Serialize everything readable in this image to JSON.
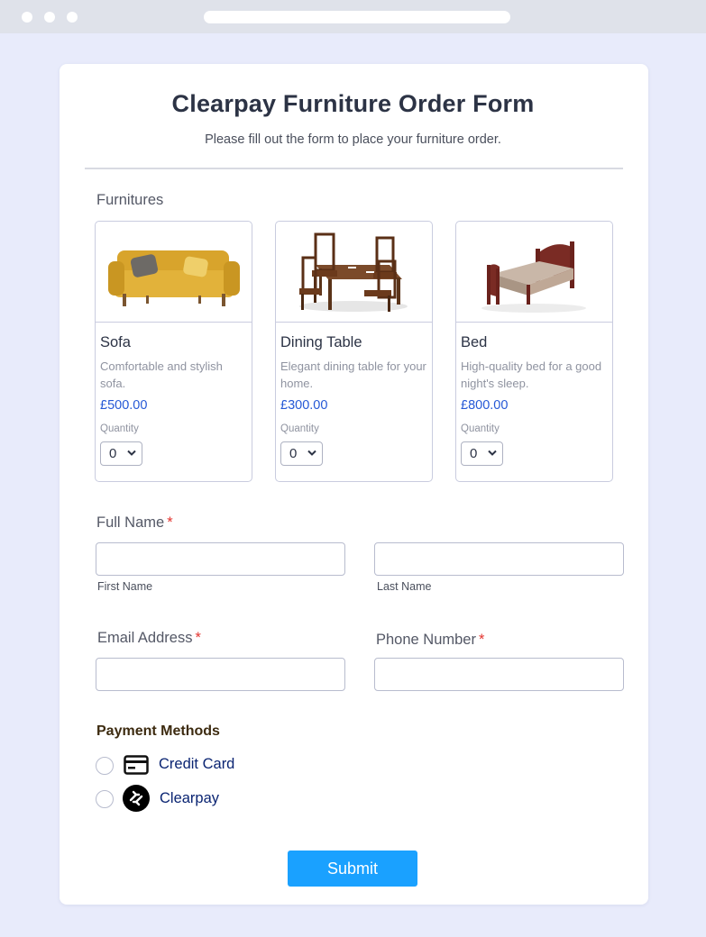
{
  "form": {
    "title": "Clearpay Furniture Order Form",
    "subtitle": "Please fill out the form to place your furniture order."
  },
  "furnitures": {
    "label": "Furnitures",
    "quantity_label": "Quantity",
    "products": [
      {
        "name": "Sofa",
        "description": "Comfortable and stylish sofa.",
        "price": "£500.00",
        "quantity": "0",
        "image_icon": "sofa-image"
      },
      {
        "name": "Dining Table",
        "description": "Elegant dining table for your home.",
        "price": "£300.00",
        "quantity": "0",
        "image_icon": "dining-table-image"
      },
      {
        "name": "Bed",
        "description": "High-quality bed for a good night's sleep.",
        "price": "£800.00",
        "quantity": "0",
        "image_icon": "bed-image"
      }
    ]
  },
  "full_name": {
    "label": "Full Name",
    "required_mark": "*",
    "first_name_sublabel": "First Name",
    "last_name_sublabel": "Last Name",
    "first_name_value": "",
    "last_name_value": ""
  },
  "email": {
    "label": "Email Address",
    "required_mark": "*",
    "value": ""
  },
  "phone": {
    "label": "Phone Number",
    "required_mark": "*",
    "value": ""
  },
  "payment": {
    "label": "Payment Methods",
    "options": [
      {
        "label": "Credit Card",
        "icon": "credit-card-icon",
        "selected": false
      },
      {
        "label": "Clearpay",
        "icon": "clearpay-logo-icon",
        "selected": false
      }
    ]
  },
  "submit_label": "Submit",
  "colors": {
    "page_background": "#e8ebfb",
    "accent": "#1aa1ff",
    "price": "#2659d6",
    "required": "#e3342f",
    "payment_text": "#0a2472"
  }
}
